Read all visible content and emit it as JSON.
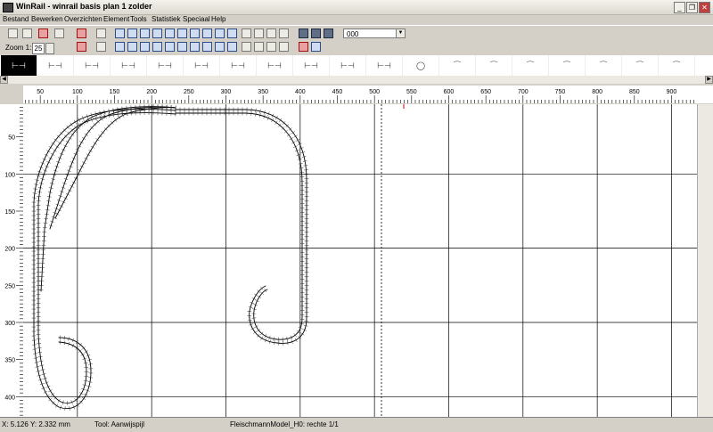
{
  "window": {
    "title": "WinRail - winrail basis plan 1 zolder",
    "minimize": "_",
    "restore": "❐",
    "close": "✕"
  },
  "menu": [
    "Bestand",
    "Bewerken",
    "Overzichten",
    "Element",
    "Tools",
    "Statistiek",
    "Speciaal",
    "Help"
  ],
  "toolbar": {
    "zoom_label": "Zoom 1:",
    "zoom_value": "25",
    "layer_value": "000"
  },
  "palette_count": 19,
  "ruler": {
    "x_labels": [
      "50",
      "100",
      "150",
      "200",
      "250",
      "300",
      "350",
      "400",
      "450",
      "500",
      "550",
      "600",
      "650",
      "700",
      "750",
      "800",
      "850",
      "900"
    ],
    "y_labels": [
      "50",
      "100",
      "150",
      "200",
      "250",
      "300",
      "350",
      "400"
    ]
  },
  "status": {
    "x": "X: 5.126",
    "y": "Y: 2.332 mm",
    "tool": "Tool: Aanwijspijl",
    "element": "FleischmannModel_H0: rechte 1/1"
  },
  "colors": {
    "track": "#000000",
    "grid": "#000000",
    "cursor_marker": "#cc0000"
  }
}
